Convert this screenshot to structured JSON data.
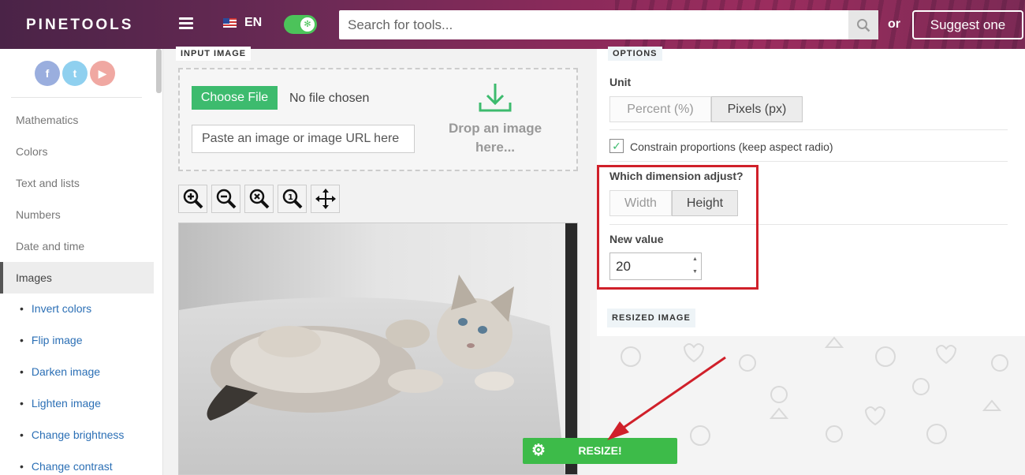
{
  "header": {
    "logo": "PINETOOLS",
    "language": "EN",
    "search_placeholder": "Search for tools...",
    "or_text": "or",
    "suggest_label": "Suggest one"
  },
  "sidebar": {
    "social": [
      "f",
      "t",
      "▶"
    ],
    "categories": [
      "Mathematics",
      "Colors",
      "Text and lists",
      "Numbers",
      "Date and time",
      "Images"
    ],
    "active_category": "Images",
    "subitems": [
      "Invert colors",
      "Flip image",
      "Darken image",
      "Lighten image",
      "Change brightness",
      "Change contrast"
    ]
  },
  "input_panel": {
    "tab_label": "INPUT IMAGE",
    "choose_file_label": "Choose File",
    "no_file_text": "No file chosen",
    "paste_placeholder": "Paste an image or image URL here",
    "drop_text_line1": "Drop an image",
    "drop_text_line2": "here..."
  },
  "options": {
    "tab_label": "OPTIONS",
    "unit_label": "Unit",
    "unit_options": [
      "Percent (%)",
      "Pixels (px)"
    ],
    "unit_selected": "Pixels (px)",
    "constrain_label": "Constrain proportions (keep aspect radio)",
    "constrain_checked": true,
    "dimension_label": "Which dimension adjust?",
    "dimension_options": [
      "Width",
      "Height"
    ],
    "dimension_selected": "Height",
    "new_value_label": "New value",
    "new_value": "20"
  },
  "resized": {
    "tab_label": "RESIZED IMAGE"
  },
  "resize_button": {
    "label": "RESIZE!"
  },
  "colors": {
    "accent_green": "#3dbb6e",
    "highlight_red": "#d0202a",
    "link_blue": "#2b6fb5"
  }
}
